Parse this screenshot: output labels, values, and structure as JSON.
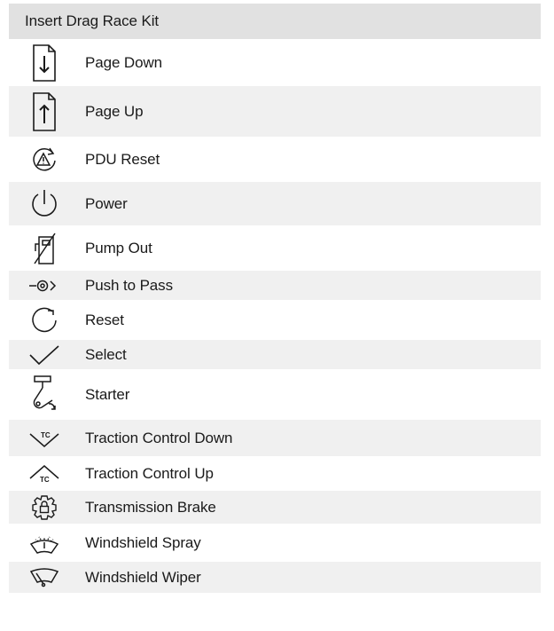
{
  "table": {
    "header": "Insert Drag Race Kit",
    "rows": [
      {
        "icon": "page-down-icon",
        "label": "Page Down"
      },
      {
        "icon": "page-up-icon",
        "label": "Page Up"
      },
      {
        "icon": "pdu-reset-icon",
        "label": "PDU Reset"
      },
      {
        "icon": "power-icon",
        "label": "Power"
      },
      {
        "icon": "pump-out-icon",
        "label": "Pump Out"
      },
      {
        "icon": "push-to-pass-icon",
        "label": "Push to Pass"
      },
      {
        "icon": "reset-icon",
        "label": "Reset"
      },
      {
        "icon": "select-icon",
        "label": "Select"
      },
      {
        "icon": "starter-icon",
        "label": "Starter"
      },
      {
        "icon": "traction-control-down-icon",
        "label": "Traction Control Down"
      },
      {
        "icon": "traction-control-up-icon",
        "label": "Traction Control Up"
      },
      {
        "icon": "transmission-brake-icon",
        "label": "Transmission Brake"
      },
      {
        "icon": "windshield-spray-icon",
        "label": "Windshield Spray"
      },
      {
        "icon": "windshield-wiper-icon",
        "label": "Windshield Wiper"
      }
    ]
  }
}
